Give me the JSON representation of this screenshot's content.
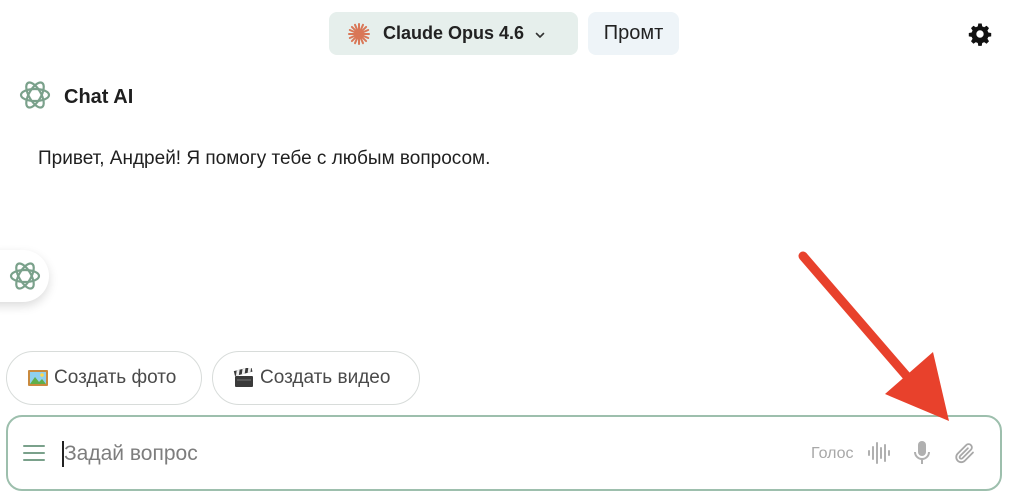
{
  "header": {
    "model_label": "Claude Opus 4.6",
    "prompt_label": "Промт"
  },
  "chat": {
    "bot_name": "Chat AI",
    "messages": [
      {
        "text": "Привет, Андрей! Я помогу тебе с любым вопросом."
      }
    ]
  },
  "quick_actions": [
    {
      "label": "Создать фото",
      "icon": "framed-picture-emoji"
    },
    {
      "label": "Создать видео",
      "icon": "clapper-board-emoji"
    }
  ],
  "composer": {
    "placeholder": "Задай вопрос",
    "value": "",
    "voice_label": "Голос"
  },
  "colors": {
    "accent_green": "#9dbfad",
    "model_bg": "#e6efec",
    "claude_orange": "#d97757",
    "annotation_red": "#e8412c"
  }
}
